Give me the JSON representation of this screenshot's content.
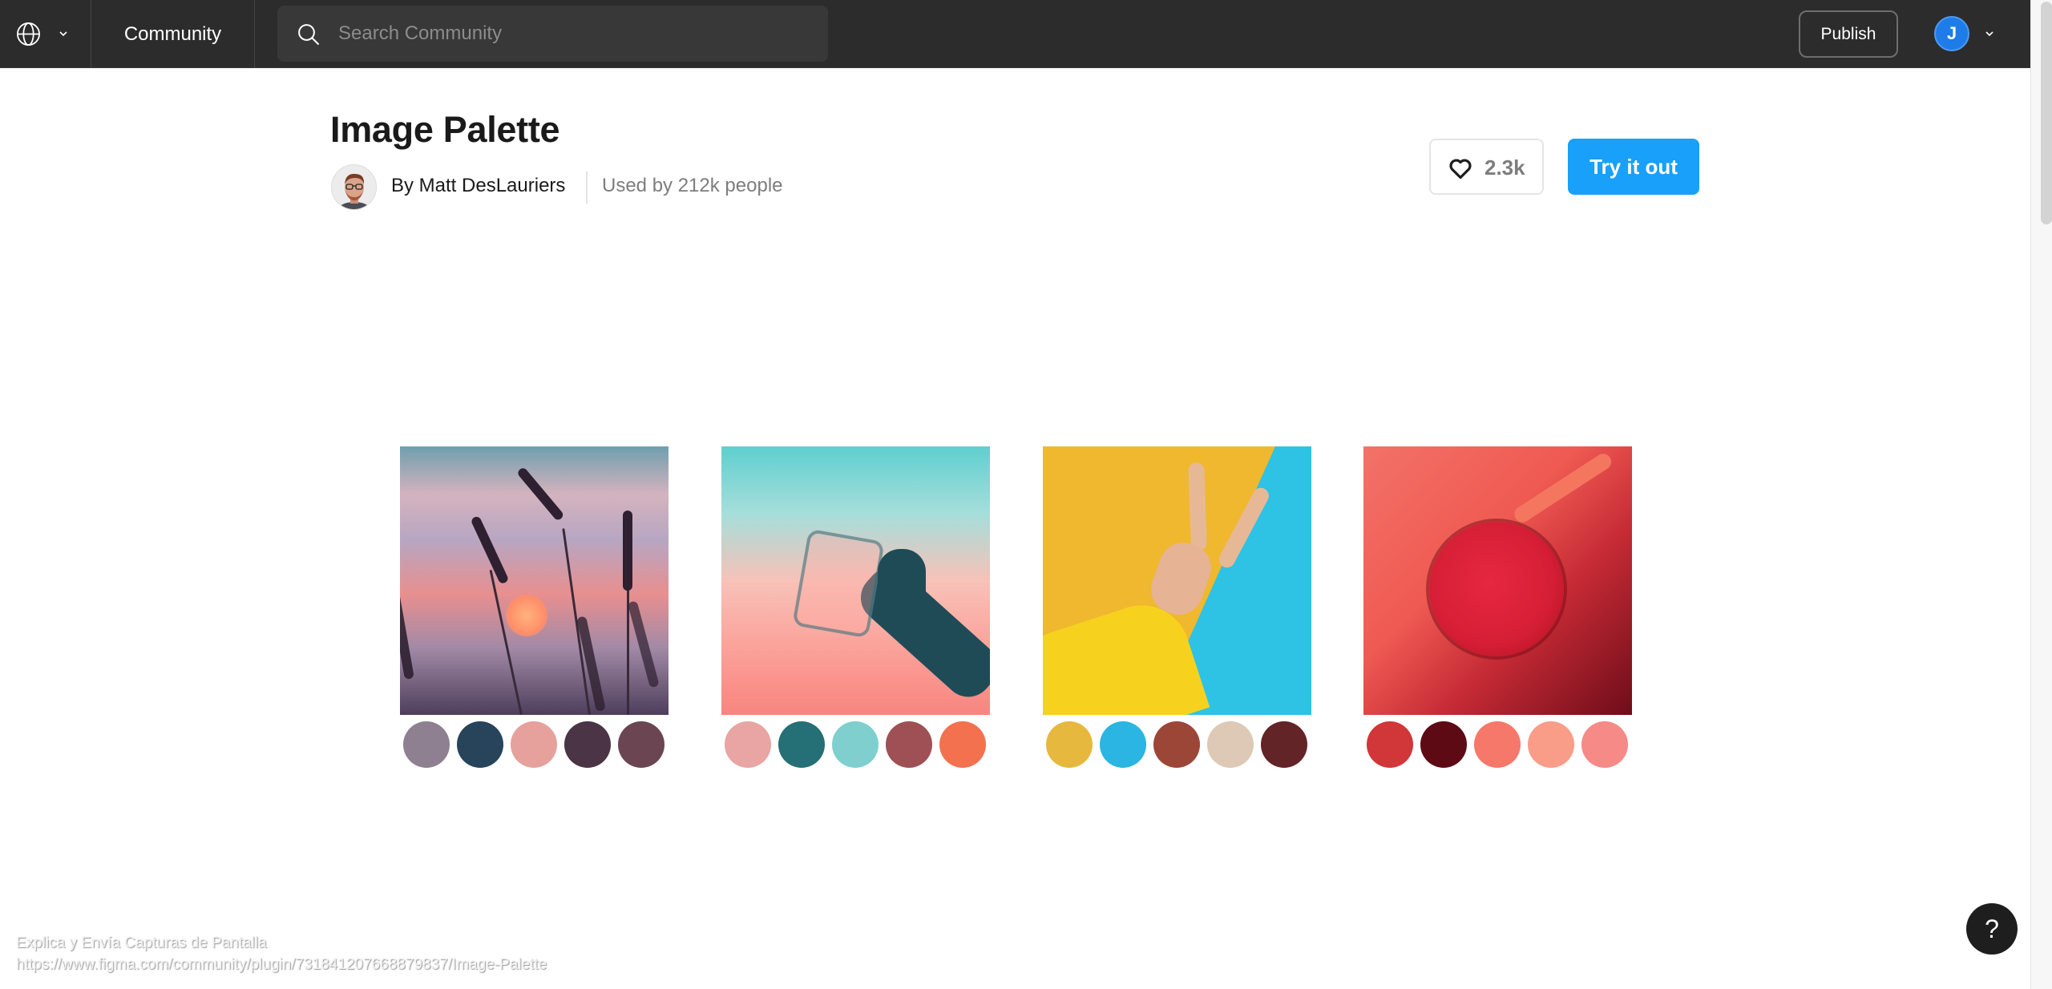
{
  "header": {
    "language_icon": "globe-icon",
    "community_label": "Community",
    "search": {
      "placeholder": "Search Community",
      "value": ""
    },
    "publish_label": "Publish",
    "user": {
      "initial": "J",
      "avatar_color": "#1e7ce8"
    }
  },
  "plugin": {
    "title": "Image Palette",
    "author": "By Matt DesLauriers",
    "usage": "Used by 212k people",
    "likes": "2.3k",
    "try_label": "Try it out",
    "accent_color": "#18a0fb"
  },
  "gallery": [
    {
      "subject": "sunset over grass",
      "swatches": [
        "#8e8091",
        "#27445a",
        "#e6a19d",
        "#4a3445",
        "#6b4552"
      ]
    },
    {
      "subject": "hand holding glass jar",
      "swatches": [
        "#e8a5a3",
        "#256f76",
        "#7fcfcf",
        "#9e5055",
        "#f3714f"
      ]
    },
    {
      "subject": "peace sign hand on yellow and blue",
      "swatches": [
        "#e7b83e",
        "#2ab5e2",
        "#9c4638",
        "#ddc9b6",
        "#632427"
      ]
    },
    {
      "subject": "red drink top view",
      "swatches": [
        "#d13639",
        "#5e0a15",
        "#f6786a",
        "#f99c88",
        "#f68a87"
      ]
    }
  ],
  "overlay": {
    "line1": "Explica y Envía Capturas de Pantalla",
    "line2": "https://www.figma.com/community/plugin/731841207668879837/Image-Palette"
  },
  "help_label": "?"
}
